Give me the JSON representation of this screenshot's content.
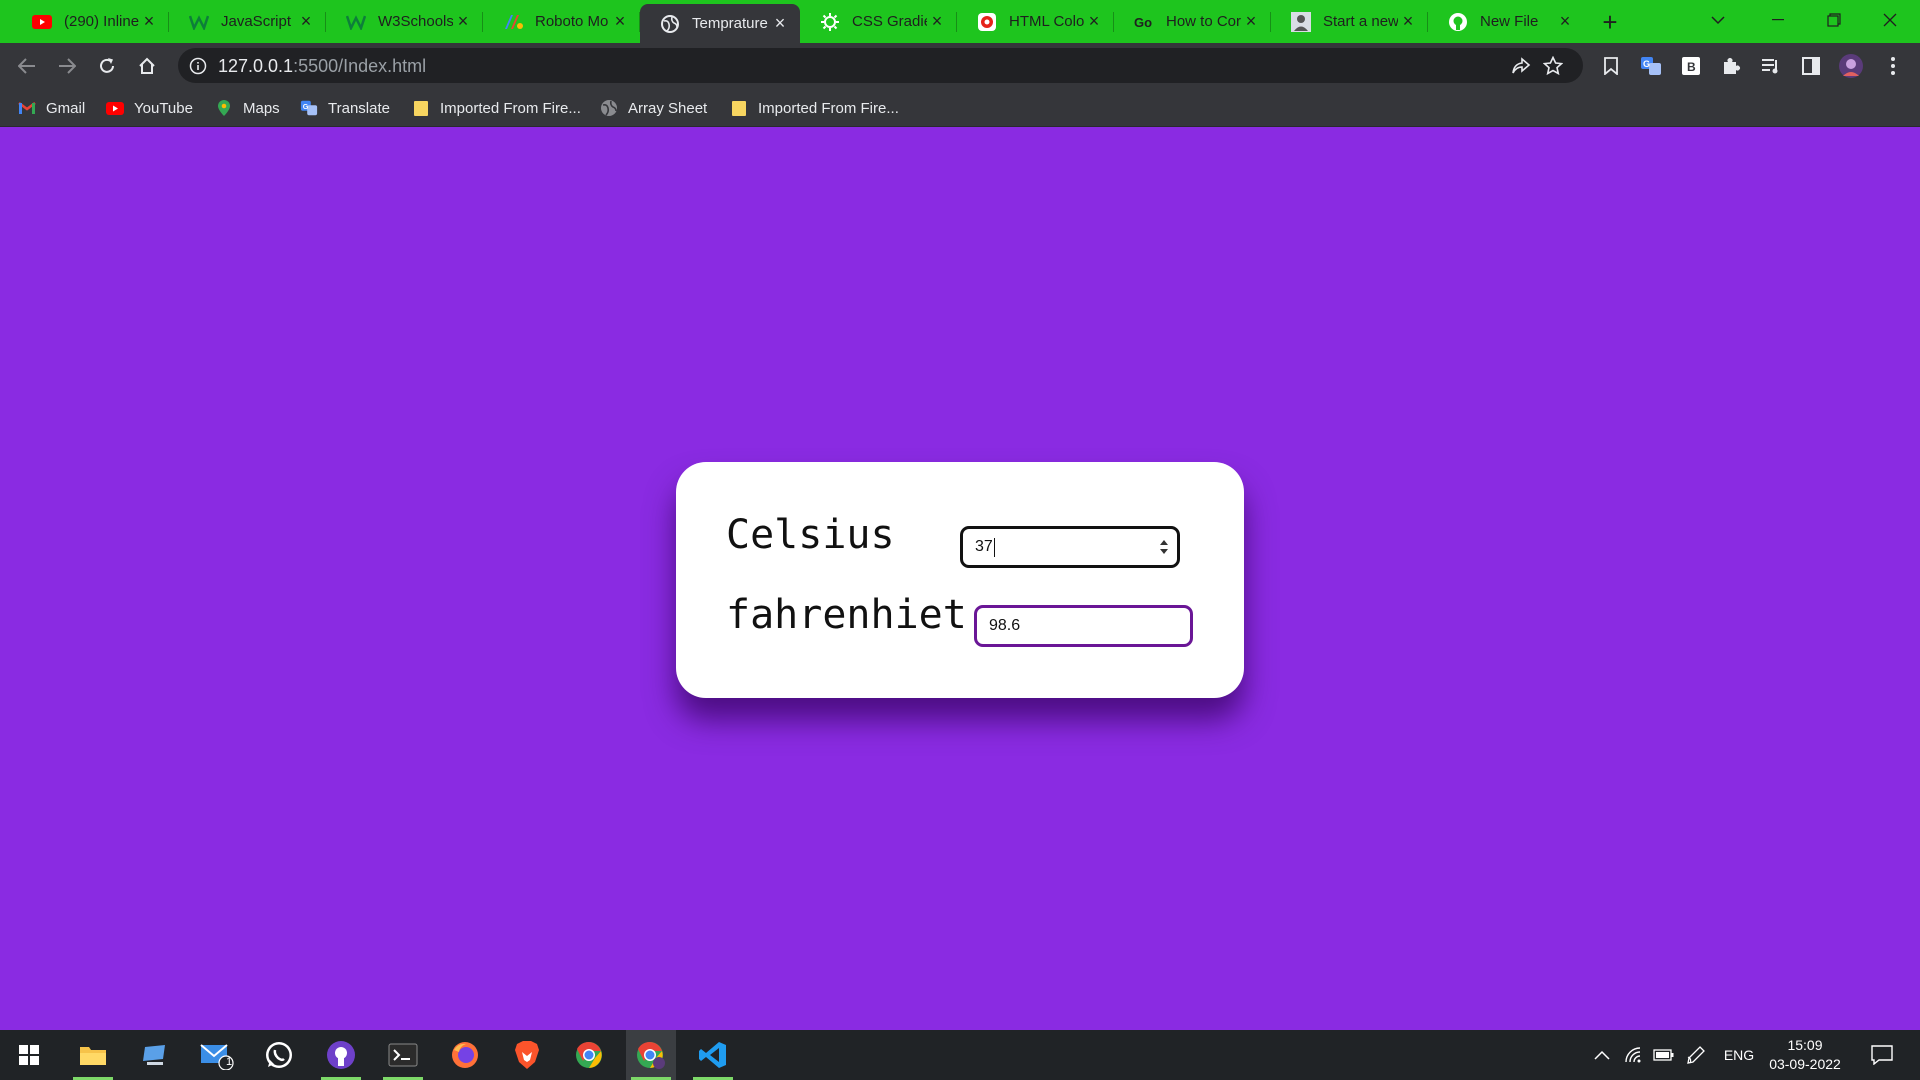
{
  "browser": {
    "tabs": [
      {
        "title": "(290) Inline",
        "icon": "youtube-icon",
        "active": false
      },
      {
        "title": "JavaScript E",
        "icon": "w3schools-icon",
        "active": false
      },
      {
        "title": "W3Schools",
        "icon": "w3schools-icon",
        "active": false
      },
      {
        "title": "Roboto Mo",
        "icon": "google-fonts-icon",
        "active": false
      },
      {
        "title": "Temprature",
        "icon": "globe-icon",
        "active": true
      },
      {
        "title": "CSS Gradie",
        "icon": "gear-icon",
        "active": false
      },
      {
        "title": "HTML Colo",
        "icon": "html-color-icon",
        "active": false
      },
      {
        "title": "How to Cor",
        "icon": "chain-icon",
        "active": false
      },
      {
        "title": "Start a new",
        "icon": "avatar-icon",
        "active": false
      },
      {
        "title": "New File",
        "icon": "github-icon",
        "active": false
      }
    ],
    "new_tab_label": "+",
    "address": {
      "host": "127.0.0.1",
      "rest": ":5500/Index.html"
    },
    "bookmarks": [
      {
        "label": "Gmail",
        "icon": "gmail-icon"
      },
      {
        "label": "YouTube",
        "icon": "youtube-icon"
      },
      {
        "label": "Maps",
        "icon": "maps-icon"
      },
      {
        "label": "Translate",
        "icon": "translate-icon"
      },
      {
        "label": "Imported From Fire...",
        "icon": "folder-icon"
      },
      {
        "label": "Array Sheet",
        "icon": "globe-icon"
      },
      {
        "label": "Imported From Fire...",
        "icon": "folder-icon"
      }
    ]
  },
  "page": {
    "background_color": "#8a2be2",
    "card": {
      "celsius_label": "Celsius",
      "celsius_value": "37",
      "fahrenheit_label": "fahrenhiet",
      "fahrenheit_value": "98.6"
    }
  },
  "taskbar": {
    "apps": [
      "windows-start-icon",
      "file-explorer-icon",
      "this-pc-icon",
      "mail-icon",
      "whatsapp-icon",
      "github-desktop-icon",
      "terminal-icon",
      "firefox-icon",
      "brave-icon",
      "chrome-icon",
      "chrome-profile-icon",
      "vscode-icon"
    ],
    "mail_badge": "1",
    "language": "ENG",
    "time": "15:09",
    "date": "03-09-2022"
  }
}
